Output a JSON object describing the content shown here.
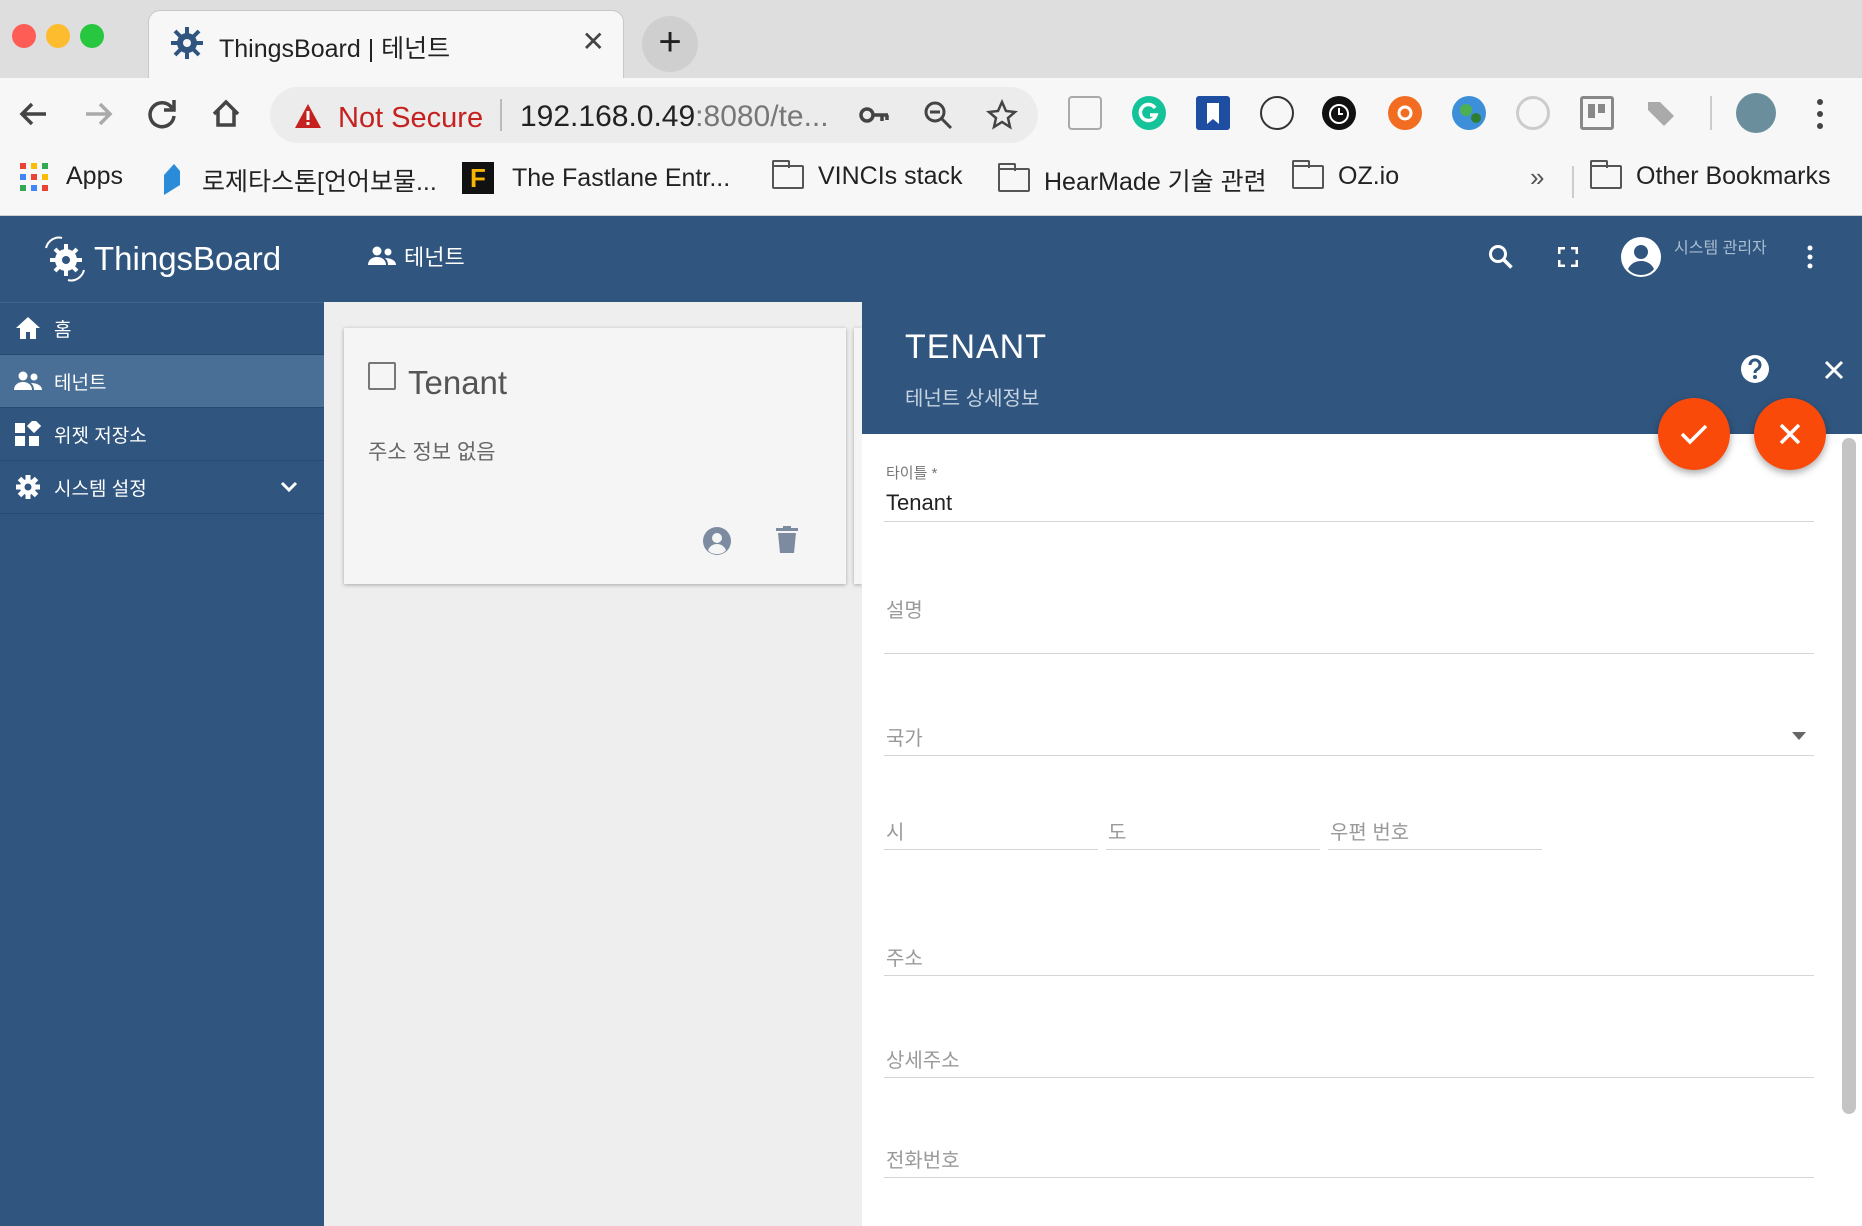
{
  "browser": {
    "tab_title": "ThingsBoard | 테넌트",
    "tab_close": "✕",
    "new_tab": "+",
    "not_secure": "Not Secure",
    "url_host": "192.168.0.49",
    "url_rest": ":8080/te...",
    "bookmarks": [
      {
        "label": "Apps"
      },
      {
        "label": "로제타스톤[언어보물..."
      },
      {
        "label": "The Fastlane Entr..."
      },
      {
        "label": "VINCIs stack"
      },
      {
        "label": "HearMade 기술 관련"
      },
      {
        "label": "OZ.io"
      },
      {
        "label": "Other Bookmarks"
      }
    ],
    "overflow": "»"
  },
  "app": {
    "logo": "ThingsBoard",
    "sidebar": [
      {
        "label": "홈",
        "icon": "home-icon"
      },
      {
        "label": "테넌트",
        "icon": "people-icon"
      },
      {
        "label": "위젯 저장소",
        "icon": "widgets-icon"
      },
      {
        "label": "시스템 설정",
        "icon": "gear-icon"
      }
    ],
    "page_title": "테넌트",
    "user_role": "시스템 관리자"
  },
  "card": {
    "title": "Tenant",
    "subtitle": "주소 정보 없음"
  },
  "details": {
    "title": "TENANT",
    "subtitle": "테넌트 상세정보",
    "fields": {
      "title_label": "타이틀 *",
      "title_value": "Tenant",
      "description": "설명",
      "country": "국가",
      "city": "시",
      "state": "도",
      "zip": "우편 번호",
      "address": "주소",
      "address2": "상세주소",
      "phone": "전화번호"
    }
  },
  "colors": {
    "primary": "#305680",
    "accent": "#fa4a0a",
    "not_secure": "#c5221f"
  }
}
